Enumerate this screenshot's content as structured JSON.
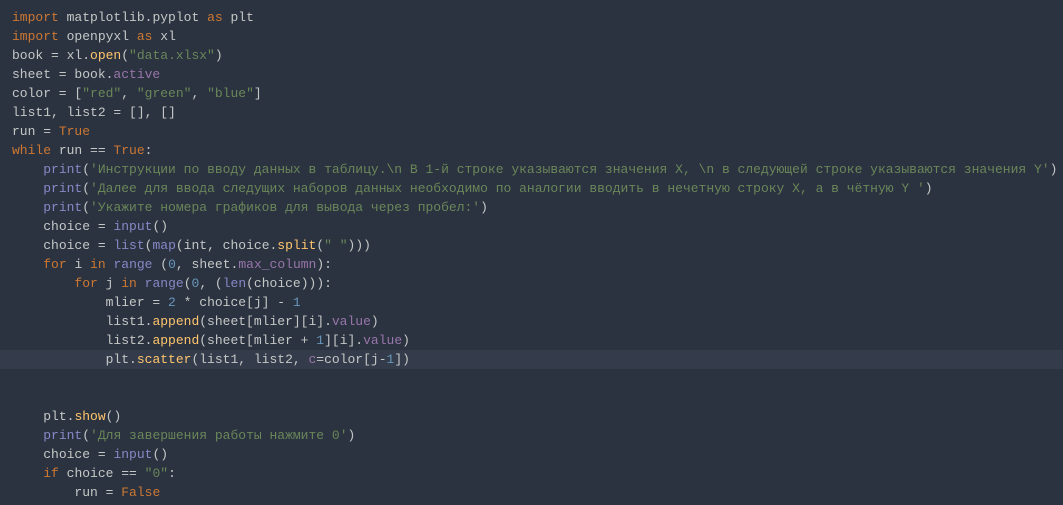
{
  "code": {
    "lines": [
      {
        "indent": 0,
        "tokens": [
          {
            "t": "kw",
            "v": "import"
          },
          {
            "t": "sp",
            "v": " "
          },
          {
            "t": "id",
            "v": "matplotlib.pyplot "
          },
          {
            "t": "kw",
            "v": "as"
          },
          {
            "t": "sp",
            "v": " "
          },
          {
            "t": "id",
            "v": "plt"
          }
        ]
      },
      {
        "indent": 0,
        "tokens": [
          {
            "t": "kw",
            "v": "import"
          },
          {
            "t": "sp",
            "v": " "
          },
          {
            "t": "id",
            "v": "openpyxl "
          },
          {
            "t": "kw",
            "v": "as"
          },
          {
            "t": "sp",
            "v": " "
          },
          {
            "t": "id",
            "v": "xl"
          }
        ]
      },
      {
        "indent": 0,
        "tokens": [
          {
            "t": "id",
            "v": "book = xl."
          },
          {
            "t": "fn",
            "v": "open"
          },
          {
            "t": "id",
            "v": "("
          },
          {
            "t": "str",
            "v": "\"data.xlsx\""
          },
          {
            "t": "id",
            "v": ")"
          }
        ]
      },
      {
        "indent": 0,
        "tokens": [
          {
            "t": "id",
            "v": "sheet = book."
          },
          {
            "t": "attr",
            "v": "active"
          }
        ]
      },
      {
        "indent": 0,
        "tokens": [
          {
            "t": "id",
            "v": "color = ["
          },
          {
            "t": "str",
            "v": "\"red\""
          },
          {
            "t": "id",
            "v": ", "
          },
          {
            "t": "str",
            "v": "\"green\""
          },
          {
            "t": "id",
            "v": ", "
          },
          {
            "t": "str",
            "v": "\"blue\""
          },
          {
            "t": "id",
            "v": "]"
          }
        ]
      },
      {
        "indent": 0,
        "tokens": [
          {
            "t": "id",
            "v": "list1, list2 = [], []"
          }
        ]
      },
      {
        "indent": 0,
        "tokens": [
          {
            "t": "id",
            "v": "run = "
          },
          {
            "t": "const",
            "v": "True"
          }
        ]
      },
      {
        "indent": 0,
        "tokens": [
          {
            "t": "kw",
            "v": "while"
          },
          {
            "t": "sp",
            "v": " "
          },
          {
            "t": "id",
            "v": "run == "
          },
          {
            "t": "const",
            "v": "True"
          },
          {
            "t": "id",
            "v": ":"
          }
        ]
      },
      {
        "indent": 1,
        "tokens": [
          {
            "t": "builtin",
            "v": "print"
          },
          {
            "t": "id",
            "v": "("
          },
          {
            "t": "str",
            "v": "'Инструкции по вводу данных в таблицу.\\n В 1-й строке указываются значения X, \\n в следующей строке указываются значения Y'"
          },
          {
            "t": "id",
            "v": ")"
          }
        ]
      },
      {
        "indent": 1,
        "tokens": [
          {
            "t": "builtin",
            "v": "print"
          },
          {
            "t": "id",
            "v": "("
          },
          {
            "t": "str",
            "v": "'Далее для ввода следущих наборов данных необходимо по аналогии вводить в нечетную строку X, а в чётную Y '"
          },
          {
            "t": "id",
            "v": ")"
          }
        ]
      },
      {
        "indent": 1,
        "tokens": [
          {
            "t": "builtin",
            "v": "print"
          },
          {
            "t": "id",
            "v": "("
          },
          {
            "t": "str",
            "v": "'Укажите номера графиков для вывода через пробел:'"
          },
          {
            "t": "id",
            "v": ")"
          }
        ]
      },
      {
        "indent": 1,
        "tokens": [
          {
            "t": "id",
            "v": "choice = "
          },
          {
            "t": "builtin",
            "v": "input"
          },
          {
            "t": "id",
            "v": "()"
          }
        ]
      },
      {
        "indent": 1,
        "tokens": [
          {
            "t": "id",
            "v": "choice = "
          },
          {
            "t": "builtin",
            "v": "list"
          },
          {
            "t": "id",
            "v": "("
          },
          {
            "t": "builtin",
            "v": "map"
          },
          {
            "t": "id",
            "v": "(int, choice."
          },
          {
            "t": "fn",
            "v": "split"
          },
          {
            "t": "id",
            "v": "("
          },
          {
            "t": "str",
            "v": "\" \""
          },
          {
            "t": "id",
            "v": ")))"
          }
        ]
      },
      {
        "indent": 1,
        "tokens": [
          {
            "t": "kw",
            "v": "for"
          },
          {
            "t": "sp",
            "v": " "
          },
          {
            "t": "id",
            "v": "i "
          },
          {
            "t": "kw",
            "v": "in"
          },
          {
            "t": "sp",
            "v": " "
          },
          {
            "t": "builtin",
            "v": "range"
          },
          {
            "t": "sp",
            "v": " "
          },
          {
            "t": "id",
            "v": "("
          },
          {
            "t": "num",
            "v": "0"
          },
          {
            "t": "id",
            "v": ", sheet."
          },
          {
            "t": "attr",
            "v": "max_column"
          },
          {
            "t": "id",
            "v": "):"
          }
        ]
      },
      {
        "indent": 2,
        "tokens": [
          {
            "t": "kw",
            "v": "for"
          },
          {
            "t": "sp",
            "v": " "
          },
          {
            "t": "id",
            "v": "j "
          },
          {
            "t": "kw",
            "v": "in"
          },
          {
            "t": "sp",
            "v": " "
          },
          {
            "t": "builtin",
            "v": "range"
          },
          {
            "t": "id",
            "v": "("
          },
          {
            "t": "num",
            "v": "0"
          },
          {
            "t": "id",
            "v": ", ("
          },
          {
            "t": "builtin",
            "v": "len"
          },
          {
            "t": "id",
            "v": "(choice))):"
          }
        ]
      },
      {
        "indent": 3,
        "tokens": [
          {
            "t": "id",
            "v": "mlier = "
          },
          {
            "t": "num",
            "v": "2"
          },
          {
            "t": "id",
            "v": " * choice[j] - "
          },
          {
            "t": "num",
            "v": "1"
          }
        ]
      },
      {
        "indent": 3,
        "tokens": [
          {
            "t": "id",
            "v": "list1."
          },
          {
            "t": "fn",
            "v": "append"
          },
          {
            "t": "id",
            "v": "(sheet[mlier][i]."
          },
          {
            "t": "attr",
            "v": "value"
          },
          {
            "t": "id",
            "v": ")"
          }
        ]
      },
      {
        "indent": 3,
        "tokens": [
          {
            "t": "id",
            "v": "list2."
          },
          {
            "t": "fn",
            "v": "append"
          },
          {
            "t": "id",
            "v": "(sheet[mlier + "
          },
          {
            "t": "num",
            "v": "1"
          },
          {
            "t": "id",
            "v": "][i]."
          },
          {
            "t": "attr",
            "v": "value"
          },
          {
            "t": "id",
            "v": ")"
          }
        ]
      },
      {
        "indent": 3,
        "highlight": true,
        "tokens": [
          {
            "t": "id",
            "v": "plt."
          },
          {
            "t": "fn",
            "v": "scatter"
          },
          {
            "t": "id",
            "v": "(list1, list2, "
          },
          {
            "t": "attr",
            "v": "c"
          },
          {
            "t": "id",
            "v": "=color[j-"
          },
          {
            "t": "num",
            "v": "1"
          },
          {
            "t": "id",
            "v": "])"
          }
        ]
      },
      {
        "indent": 0,
        "tokens": []
      },
      {
        "indent": 0,
        "tokens": []
      },
      {
        "indent": 1,
        "tokens": [
          {
            "t": "id",
            "v": "plt."
          },
          {
            "t": "fn",
            "v": "show"
          },
          {
            "t": "id",
            "v": "()"
          }
        ]
      },
      {
        "indent": 1,
        "tokens": [
          {
            "t": "builtin",
            "v": "print"
          },
          {
            "t": "id",
            "v": "("
          },
          {
            "t": "str",
            "v": "'Для завершения работы нажмите 0'"
          },
          {
            "t": "id",
            "v": ")"
          }
        ]
      },
      {
        "indent": 1,
        "tokens": [
          {
            "t": "id",
            "v": "choice = "
          },
          {
            "t": "builtin",
            "v": "input"
          },
          {
            "t": "id",
            "v": "()"
          }
        ]
      },
      {
        "indent": 1,
        "tokens": [
          {
            "t": "kw",
            "v": "if"
          },
          {
            "t": "sp",
            "v": " "
          },
          {
            "t": "id",
            "v": "choice == "
          },
          {
            "t": "str",
            "v": "\"0\""
          },
          {
            "t": "id",
            "v": ":"
          }
        ]
      },
      {
        "indent": 2,
        "tokens": [
          {
            "t": "id",
            "v": "run = "
          },
          {
            "t": "const",
            "v": "False"
          }
        ]
      }
    ]
  }
}
